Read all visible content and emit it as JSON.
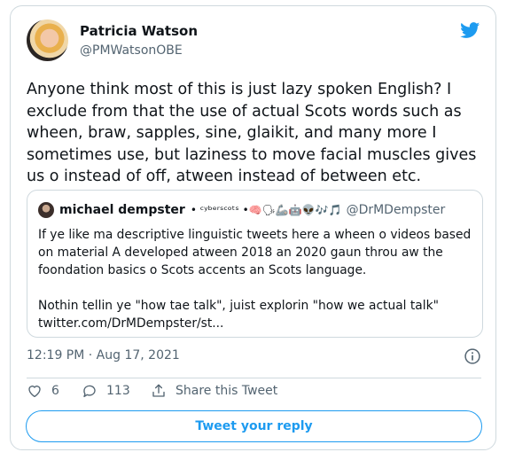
{
  "author": {
    "name": "Patricia Watson",
    "handle": "@PMWatsonOBE"
  },
  "tweet": {
    "text": "Anyone think most of this is just lazy spoken English?  I exclude from that the use of actual Scots words such as wheen, braw, sapples, sine, glaikit, and many more I sometimes use, but laziness to move facial muscles gives us o instead of off, atween instead of between etc.",
    "timestamp": "12:19 PM · Aug 17, 2021"
  },
  "quoted": {
    "name": "michael dempster",
    "name_extra": "• ᶜʸᵇᵉʳˢᶜᵒᵗˢ •🧠🗣🦾🤖👽🎶🎵",
    "handle": "@DrMDempster",
    "paragraph1": "If ye like ma descriptive linguistic tweets here a wheen o videos based on material A developed atween 2018 an 2020 gaun throu aw the foondation basics o Scots accents an Scots language.",
    "paragraph2": "Nothin tellin ye \"how tae talk\", juist explorin \"how we actual talk\" twitter.com/DrMDempster/st..."
  },
  "actions": {
    "likes": "6",
    "replies": "113",
    "share_label": "Share this Tweet"
  },
  "reply_button": {
    "label": "Tweet your reply"
  },
  "colors": {
    "accent": "#1d9bf0",
    "secondary_text": "#536471",
    "border": "#cfd9de"
  },
  "icons": [
    "twitter-bird-icon",
    "info-icon",
    "heart-icon",
    "reply-bubble-icon",
    "share-icon"
  ]
}
